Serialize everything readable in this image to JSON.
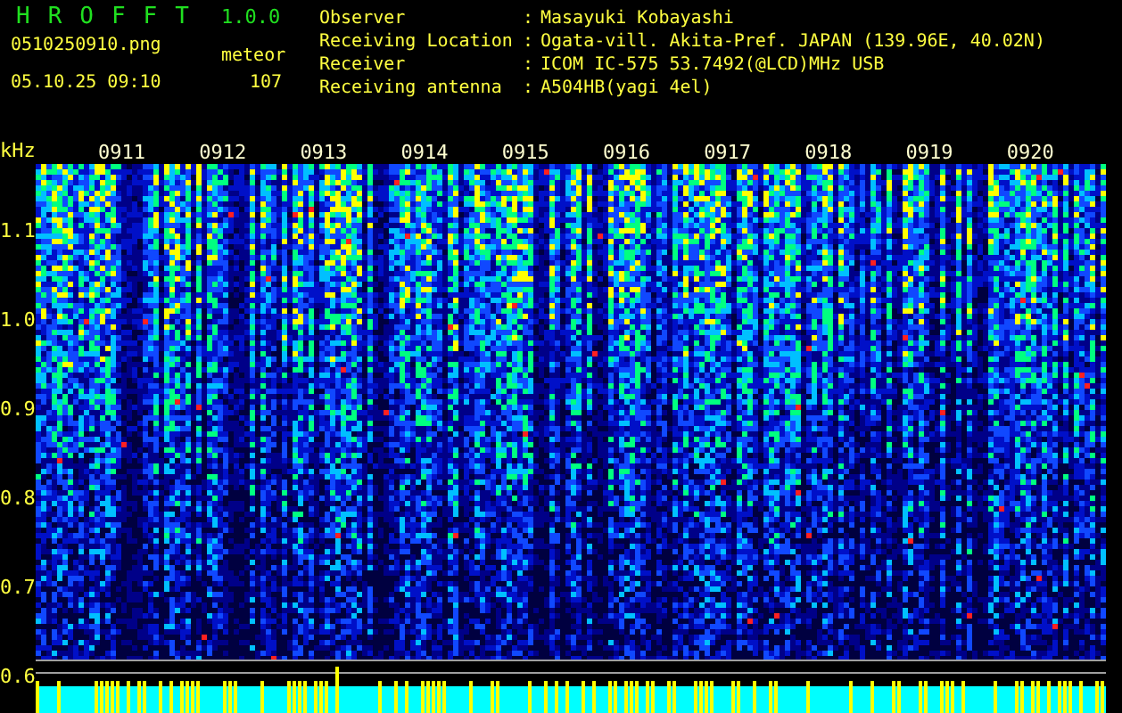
{
  "app": {
    "title": "HROFFT",
    "version": "1.0.0"
  },
  "file": "0510250910.png",
  "datetime": "05.10.25 09:10",
  "meteor": {
    "label": "meteor",
    "count": "107"
  },
  "info": [
    {
      "label": "Observer",
      "separator": ":",
      "value": "Masayuki Kobayashi"
    },
    {
      "label": "Receiving Location",
      "separator": ":",
      "value": "Ogata-vill. Akita-Pref. JAPAN (139.96E, 40.02N)"
    },
    {
      "label": "Receiver",
      "separator": ":",
      "value": "ICOM IC-575 53.7492(@LCD)MHz USB"
    },
    {
      "label": "Receiving antenna",
      "separator": ":",
      "value": "A504HB(yagi 4el)"
    }
  ],
  "spectrogram": {
    "unit": "kHz",
    "time_labels": [
      "0911",
      "0912",
      "0913",
      "0914",
      "0915",
      "0916",
      "0917",
      "0918",
      "0919",
      "0920"
    ],
    "freq_labels": [
      "1.1",
      "1.0",
      "0.9",
      "0.8",
      "0.7",
      "0.6"
    ]
  }
}
